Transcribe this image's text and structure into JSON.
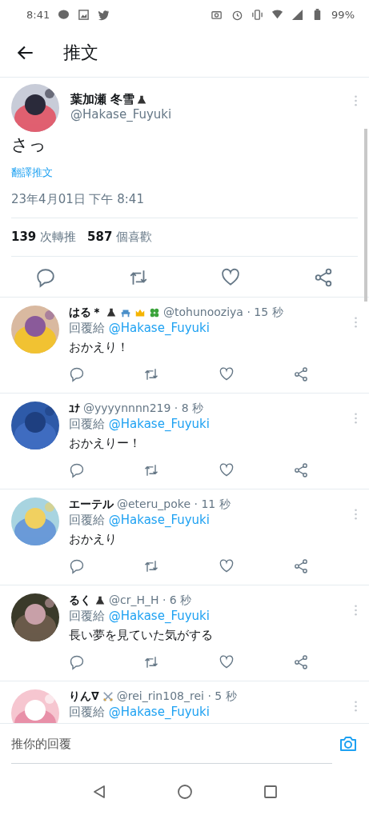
{
  "status_bar": {
    "time": "8:41",
    "battery": "99%"
  },
  "header": {
    "title": "推文"
  },
  "tweet": {
    "name": "葉加瀬 冬雪",
    "badges": [
      {
        "kind": "flask"
      }
    ],
    "handle": "@Hakase_Fuyuki",
    "text": "さっ",
    "translate": "翻譯推文",
    "timestamp": "23年4月01日 下午 8:41",
    "retweets": {
      "count": "139",
      "label": "次轉推"
    },
    "likes": {
      "count": "587",
      "label": "個喜歡"
    }
  },
  "replies": [
    {
      "name": "はる＊",
      "badges": [
        {
          "kind": "flask"
        },
        {
          "kind": "bench"
        },
        {
          "kind": "crown"
        },
        {
          "kind": "clover"
        }
      ],
      "handle": "@tohunooziya",
      "time": "· 15 秒",
      "reply_prefix": "回覆給",
      "reply_to": "@Hakase_Fuyuki",
      "text": "おかえり！"
    },
    {
      "name": "ﾕﾅ",
      "handle": "@yyyynnnn219",
      "time": "· 8 秒",
      "reply_prefix": "回覆給",
      "reply_to": "@Hakase_Fuyuki",
      "text": "おかえりー！"
    },
    {
      "name": "エーテル",
      "handle": "@eteru_poke",
      "time": "· 11 秒",
      "reply_prefix": "回覆給",
      "reply_to": "@Hakase_Fuyuki",
      "text": "おかえり"
    },
    {
      "name": "るく",
      "badges": [
        {
          "kind": "flask"
        }
      ],
      "handle": "@cr_H_H",
      "time": "· 6 秒",
      "reply_prefix": "回覆給",
      "reply_to": "@Hakase_Fuyuki",
      "text": "長い夢を見ていた気がする"
    },
    {
      "name": "りん∇",
      "badges": [
        {
          "kind": "swords"
        }
      ],
      "handle": "@rei_rin108_rei",
      "time": "· 5 秒",
      "reply_prefix": "回覆給",
      "reply_to": "@Hakase_Fuyuki"
    }
  ],
  "reply_bar": {
    "placeholder": "推你的回覆"
  }
}
